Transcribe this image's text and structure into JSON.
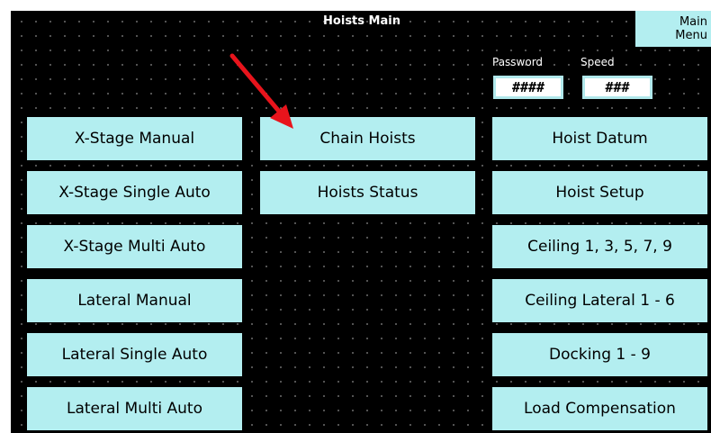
{
  "header": {
    "title": "Hoists Main",
    "main_menu_line1": "Main",
    "main_menu_line2": "Menu"
  },
  "fields": {
    "password_label": "Password",
    "password_value": "####",
    "speed_label": "Speed",
    "speed_value": "###"
  },
  "buttons": {
    "x_stage_manual": "X-Stage Manual",
    "x_stage_single_auto": "X-Stage Single Auto",
    "x_stage_multi_auto": "X-Stage Multi Auto",
    "lateral_manual": "Lateral Manual",
    "lateral_single_auto": "Lateral Single Auto",
    "lateral_multi_auto": "Lateral Multi Auto",
    "chain_hoists": "Chain Hoists",
    "hoists_status": "Hoists Status",
    "hoist_datum": "Hoist Datum",
    "hoist_setup": "Hoist Setup",
    "ceiling_odd": "Ceiling 1, 3, 5, 7, 9",
    "ceiling_lateral": "Ceiling Lateral 1 - 6",
    "docking": "Docking 1 - 9",
    "load_compensation": "Load Compensation"
  },
  "colors": {
    "background": "#000000",
    "button": "#b3eef0",
    "annotation_arrow": "#e8141c"
  },
  "icons": {
    "annotation": "red-arrow-icon"
  }
}
